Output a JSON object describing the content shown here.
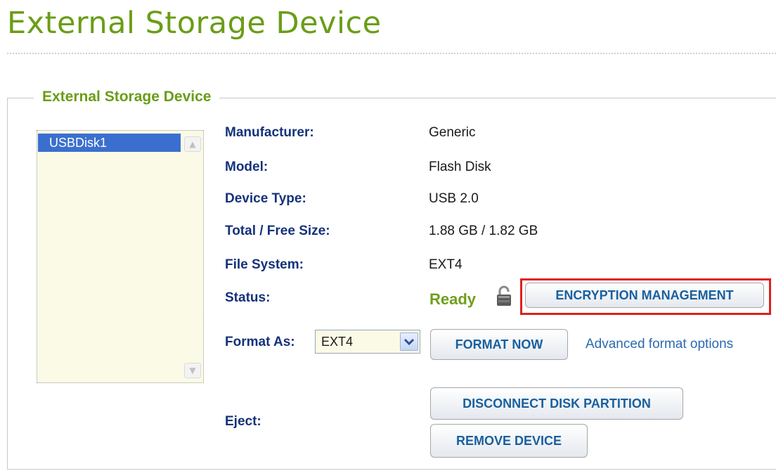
{
  "page": {
    "title": "External Storage Device"
  },
  "panel": {
    "legend": "External Storage Device"
  },
  "device_list": {
    "items": [
      "USBDisk1"
    ],
    "selected": "USBDisk1"
  },
  "details": {
    "manufacturer": {
      "label": "Manufacturer:",
      "value": "Generic"
    },
    "model": {
      "label": "Model:",
      "value": "Flash Disk"
    },
    "device_type": {
      "label": "Device Type:",
      "value": "USB 2.0"
    },
    "size": {
      "label": "Total / Free Size:",
      "value": "1.88 GB / 1.82 GB"
    },
    "file_system": {
      "label": "File System:",
      "value": "EXT4"
    },
    "status": {
      "label": "Status:",
      "value": "Ready"
    }
  },
  "actions": {
    "encryption_button": "ENCRYPTION MANAGEMENT",
    "format_label": "Format As:",
    "format_selected": "EXT4",
    "format_button": "FORMAT NOW",
    "advanced_link": "Advanced format options",
    "eject_label": "Eject:",
    "disconnect_button": "DISCONNECT DISK PARTITION",
    "remove_button": "REMOVE DEVICE"
  },
  "icons": {
    "lock": "lock-icon",
    "dropdown": "chevron-down-icon",
    "scroll_up": "scroll-up-icon",
    "scroll_down": "scroll-down-icon"
  },
  "colors": {
    "title_green": "#6a9d17",
    "label_navy": "#15327a",
    "button_text_blue": "#19609e",
    "highlight_red": "#e02020",
    "list_selected": "#3b6fcf"
  }
}
